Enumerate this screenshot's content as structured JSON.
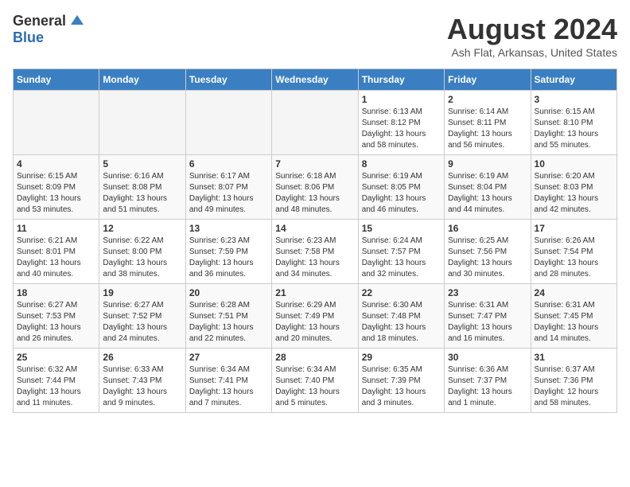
{
  "header": {
    "logo_general": "General",
    "logo_blue": "Blue",
    "main_title": "August 2024",
    "sub_title": "Ash Flat, Arkansas, United States"
  },
  "days_of_week": [
    "Sunday",
    "Monday",
    "Tuesday",
    "Wednesday",
    "Thursday",
    "Friday",
    "Saturday"
  ],
  "weeks": [
    [
      {
        "day": "",
        "info": ""
      },
      {
        "day": "",
        "info": ""
      },
      {
        "day": "",
        "info": ""
      },
      {
        "day": "",
        "info": ""
      },
      {
        "day": "1",
        "info": "Sunrise: 6:13 AM\nSunset: 8:12 PM\nDaylight: 13 hours\nand 58 minutes."
      },
      {
        "day": "2",
        "info": "Sunrise: 6:14 AM\nSunset: 8:11 PM\nDaylight: 13 hours\nand 56 minutes."
      },
      {
        "day": "3",
        "info": "Sunrise: 6:15 AM\nSunset: 8:10 PM\nDaylight: 13 hours\nand 55 minutes."
      }
    ],
    [
      {
        "day": "4",
        "info": "Sunrise: 6:15 AM\nSunset: 8:09 PM\nDaylight: 13 hours\nand 53 minutes."
      },
      {
        "day": "5",
        "info": "Sunrise: 6:16 AM\nSunset: 8:08 PM\nDaylight: 13 hours\nand 51 minutes."
      },
      {
        "day": "6",
        "info": "Sunrise: 6:17 AM\nSunset: 8:07 PM\nDaylight: 13 hours\nand 49 minutes."
      },
      {
        "day": "7",
        "info": "Sunrise: 6:18 AM\nSunset: 8:06 PM\nDaylight: 13 hours\nand 48 minutes."
      },
      {
        "day": "8",
        "info": "Sunrise: 6:19 AM\nSunset: 8:05 PM\nDaylight: 13 hours\nand 46 minutes."
      },
      {
        "day": "9",
        "info": "Sunrise: 6:19 AM\nSunset: 8:04 PM\nDaylight: 13 hours\nand 44 minutes."
      },
      {
        "day": "10",
        "info": "Sunrise: 6:20 AM\nSunset: 8:03 PM\nDaylight: 13 hours\nand 42 minutes."
      }
    ],
    [
      {
        "day": "11",
        "info": "Sunrise: 6:21 AM\nSunset: 8:01 PM\nDaylight: 13 hours\nand 40 minutes."
      },
      {
        "day": "12",
        "info": "Sunrise: 6:22 AM\nSunset: 8:00 PM\nDaylight: 13 hours\nand 38 minutes."
      },
      {
        "day": "13",
        "info": "Sunrise: 6:23 AM\nSunset: 7:59 PM\nDaylight: 13 hours\nand 36 minutes."
      },
      {
        "day": "14",
        "info": "Sunrise: 6:23 AM\nSunset: 7:58 PM\nDaylight: 13 hours\nand 34 minutes."
      },
      {
        "day": "15",
        "info": "Sunrise: 6:24 AM\nSunset: 7:57 PM\nDaylight: 13 hours\nand 32 minutes."
      },
      {
        "day": "16",
        "info": "Sunrise: 6:25 AM\nSunset: 7:56 PM\nDaylight: 13 hours\nand 30 minutes."
      },
      {
        "day": "17",
        "info": "Sunrise: 6:26 AM\nSunset: 7:54 PM\nDaylight: 13 hours\nand 28 minutes."
      }
    ],
    [
      {
        "day": "18",
        "info": "Sunrise: 6:27 AM\nSunset: 7:53 PM\nDaylight: 13 hours\nand 26 minutes."
      },
      {
        "day": "19",
        "info": "Sunrise: 6:27 AM\nSunset: 7:52 PM\nDaylight: 13 hours\nand 24 minutes."
      },
      {
        "day": "20",
        "info": "Sunrise: 6:28 AM\nSunset: 7:51 PM\nDaylight: 13 hours\nand 22 minutes."
      },
      {
        "day": "21",
        "info": "Sunrise: 6:29 AM\nSunset: 7:49 PM\nDaylight: 13 hours\nand 20 minutes."
      },
      {
        "day": "22",
        "info": "Sunrise: 6:30 AM\nSunset: 7:48 PM\nDaylight: 13 hours\nand 18 minutes."
      },
      {
        "day": "23",
        "info": "Sunrise: 6:31 AM\nSunset: 7:47 PM\nDaylight: 13 hours\nand 16 minutes."
      },
      {
        "day": "24",
        "info": "Sunrise: 6:31 AM\nSunset: 7:45 PM\nDaylight: 13 hours\nand 14 minutes."
      }
    ],
    [
      {
        "day": "25",
        "info": "Sunrise: 6:32 AM\nSunset: 7:44 PM\nDaylight: 13 hours\nand 11 minutes."
      },
      {
        "day": "26",
        "info": "Sunrise: 6:33 AM\nSunset: 7:43 PM\nDaylight: 13 hours\nand 9 minutes."
      },
      {
        "day": "27",
        "info": "Sunrise: 6:34 AM\nSunset: 7:41 PM\nDaylight: 13 hours\nand 7 minutes."
      },
      {
        "day": "28",
        "info": "Sunrise: 6:34 AM\nSunset: 7:40 PM\nDaylight: 13 hours\nand 5 minutes."
      },
      {
        "day": "29",
        "info": "Sunrise: 6:35 AM\nSunset: 7:39 PM\nDaylight: 13 hours\nand 3 minutes."
      },
      {
        "day": "30",
        "info": "Sunrise: 6:36 AM\nSunset: 7:37 PM\nDaylight: 13 hours\nand 1 minute."
      },
      {
        "day": "31",
        "info": "Sunrise: 6:37 AM\nSunset: 7:36 PM\nDaylight: 12 hours\nand 58 minutes."
      }
    ]
  ]
}
